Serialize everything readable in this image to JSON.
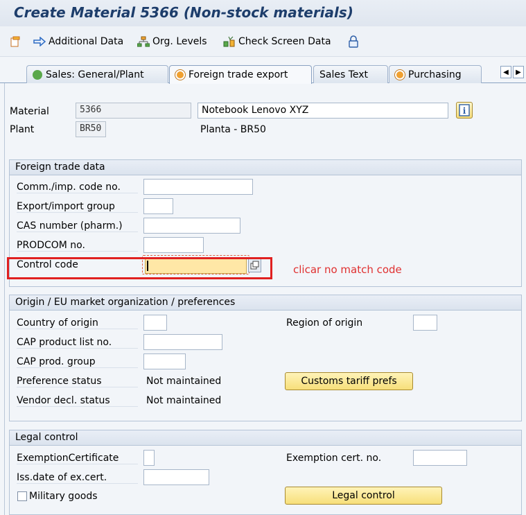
{
  "window": {
    "title": "Create Material 5366 (Non-stock materials)"
  },
  "toolbar": {
    "additional_data": "Additional Data",
    "org_levels": "Org. Levels",
    "check_screen_data": "Check Screen Data"
  },
  "tabs": [
    {
      "label": "Sales: General/Plant"
    },
    {
      "label": "Foreign trade export",
      "active": true
    },
    {
      "label": "Sales Text"
    },
    {
      "label": "Purchasing"
    }
  ],
  "header": {
    "material_label": "Material",
    "material_value": "5366",
    "material_desc": "Notebook Lenovo XYZ",
    "plant_label": "Plant",
    "plant_value": "BR50",
    "plant_desc": "Planta - BR50"
  },
  "foreign_trade": {
    "title": "Foreign trade data",
    "comm_imp_code": "Comm./imp. code no.",
    "export_import_group": "Export/import group",
    "cas_number": "CAS number (pharm.)",
    "prodcom": "PRODCOM no.",
    "control_code": "Control code",
    "control_code_value": ""
  },
  "annotation": "clicar no match code",
  "origin": {
    "title": "Origin / EU market organization / preferences",
    "country_of_origin": "Country of origin",
    "region_of_origin": "Region of origin",
    "cap_product_list": "CAP product list no.",
    "cap_prod_group": "CAP prod. group",
    "preference_status": "Preference status",
    "preference_status_value": "Not maintained",
    "vendor_decl_status": "Vendor decl. status",
    "vendor_decl_status_value": "Not maintained",
    "customs_button": "Customs tariff prefs"
  },
  "legal": {
    "title": "Legal control",
    "exemption_certificate": "ExemptionCertificate",
    "exemption_cert_no": "Exemption cert. no.",
    "iss_date": "Iss.date of ex.cert.",
    "military_goods": "Military goods",
    "legal_button": "Legal control"
  },
  "colors": {
    "title": "#1d3d6b",
    "accent_button": "#f7df7a",
    "highlight": "#e02020"
  }
}
